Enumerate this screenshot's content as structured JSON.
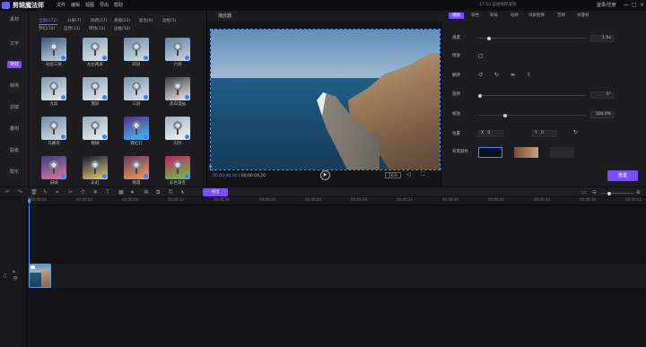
{
  "app": {
    "title": "剪辑魔法师",
    "menu": [
      "文件",
      "编辑",
      "视图",
      "导出",
      "帮助"
    ],
    "cloud_status": "17:53 自动保存成功",
    "user": "登录/注册",
    "window_buttons": [
      "—",
      "□",
      "×"
    ]
  },
  "leftnav": {
    "items": [
      {
        "label": "素材"
      },
      {
        "label": "文字"
      },
      {
        "label": "特效"
      },
      {
        "label": "转场"
      },
      {
        "label": "滤镜"
      },
      {
        "label": "叠附"
      },
      {
        "label": "贴纸"
      },
      {
        "label": "配乐"
      }
    ]
  },
  "effects": {
    "tabs_row1": [
      "全部(372)",
      "分屏(7)",
      "动感(27)",
      "基础(22)",
      "复古(6)",
      "边框(5)"
    ],
    "tabs_row2": [
      "梦幻(10)",
      "自然(13)",
      "转场(13)",
      "边框(10)"
    ],
    "items": [
      {
        "label": "动态三屏",
        "colors": [
          "#3a5a7a",
          "#c7d7e6"
        ]
      },
      {
        "label": "左右两屏",
        "colors": [
          "#8aa0b5",
          "#e2e8ee"
        ]
      },
      {
        "label": "四屏",
        "colors": [
          "#6c8aa6",
          "#dbe4ec"
        ]
      },
      {
        "label": "六屏",
        "colors": [
          "#5f7f9f",
          "#cdd9e5"
        ]
      },
      {
        "label": "九屏",
        "colors": [
          "#7f97b0",
          "#e8eef3"
        ]
      },
      {
        "label": "两屏",
        "colors": [
          "#8fa3b8",
          "#e7ecf1"
        ]
      },
      {
        "label": "三屏",
        "colors": [
          "#7994ad",
          "#dfe6ed"
        ]
      },
      {
        "label": "黑白漫画",
        "colors": [
          "#3a3a3a",
          "#f0f0f0"
        ]
      },
      {
        "label": "马赛克",
        "colors": [
          "#6f8aa5",
          "#dae3eb"
        ]
      },
      {
        "label": "模糊",
        "colors": [
          "#98aabb",
          "#eef2f5"
        ]
      },
      {
        "label": "霓虹灯",
        "colors": [
          "#5a2a8a",
          "#3cc7ff"
        ]
      },
      {
        "label": "闪烁",
        "colors": [
          "#a0b0c0",
          "#f5f7f9"
        ]
      },
      {
        "label": "旧城",
        "colors": [
          "#3a3f7a",
          "#e07aa5"
        ]
      },
      {
        "label": "彩虹",
        "colors": [
          "#101830",
          "#f0d070"
        ]
      },
      {
        "label": "晚霞",
        "colors": [
          "#6a3a5a",
          "#f0a060"
        ]
      },
      {
        "label": "彩色渐变",
        "colors": [
          "#c02060",
          "#60d040"
        ]
      }
    ]
  },
  "player": {
    "header": "播放器",
    "current_time": "00:00:00.00",
    "total_time": "00:00:04.20",
    "ratio": "16:9"
  },
  "props": {
    "tabs": [
      "视频",
      "调色",
      "高级",
      "动效",
      "绿屏抠像",
      "音频",
      "关键帧"
    ],
    "opacity_label": "透度",
    "opacity_value": "1.0x",
    "reverse_label": "倒放",
    "flip_label": "翻转",
    "rotate_label": "旋转",
    "rotate_value": "0°",
    "scale_label": "缩放",
    "scale_value": "100.0%",
    "position_label": "位置",
    "x_label": "X",
    "x_value": "0",
    "y_label": "Y",
    "y_value": "0",
    "bg_label": "背景颜色",
    "reset_label": "重置"
  },
  "toolbar": {
    "export_label": "导出",
    "icons": [
      "undo-icon",
      "redo-icon",
      "delete-icon",
      "edit-icon",
      "crop-icon",
      "split-icon",
      "speed-icon",
      "freeze-icon",
      "text-icon",
      "mosaic-icon",
      "record-icon",
      "screenshot-icon",
      "copy-icon",
      "paste-icon",
      "mute-icon",
      "zoom-out-icon",
      "zoom-in-icon"
    ]
  },
  "timeline": {
    "ticks": [
      "00:00:00",
      "00:00:04",
      "00:00:08",
      "00:00:12",
      "00:00:16",
      "00:00:20",
      "00:00:24",
      "00:00:28",
      "00:00:32",
      "00:00:36",
      "00:00:40",
      "00:00:44",
      "00:00:48",
      "00:00:52"
    ]
  }
}
